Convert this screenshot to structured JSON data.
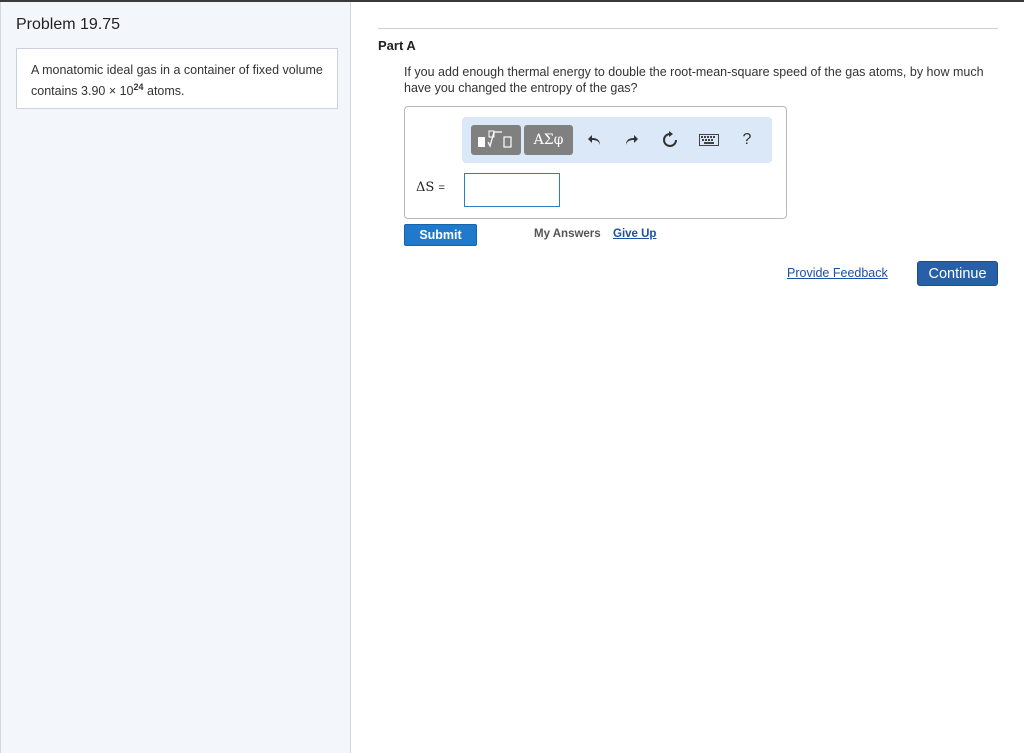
{
  "problem": {
    "title": "Problem 19.75",
    "statement_before": "A monatomic ideal gas in a container of fixed volume contains 3.90 × 10",
    "statement_exponent": "24",
    "statement_after": " atoms."
  },
  "part": {
    "label": "Part A",
    "question": "If you add enough thermal energy to double the root-mean-square speed of the gas atoms, by how much have you changed the entropy of the gas?"
  },
  "toolbar": {
    "symbols_label": "ΑΣφ",
    "help_label": "?"
  },
  "answer": {
    "label": "ΔS",
    "equals": "=",
    "value": ""
  },
  "actions": {
    "submit_label": "Submit",
    "my_answers_label": "My Answers",
    "give_up_label": "Give Up",
    "feedback_label": "Provide Feedback",
    "continue_label": "Continue"
  }
}
